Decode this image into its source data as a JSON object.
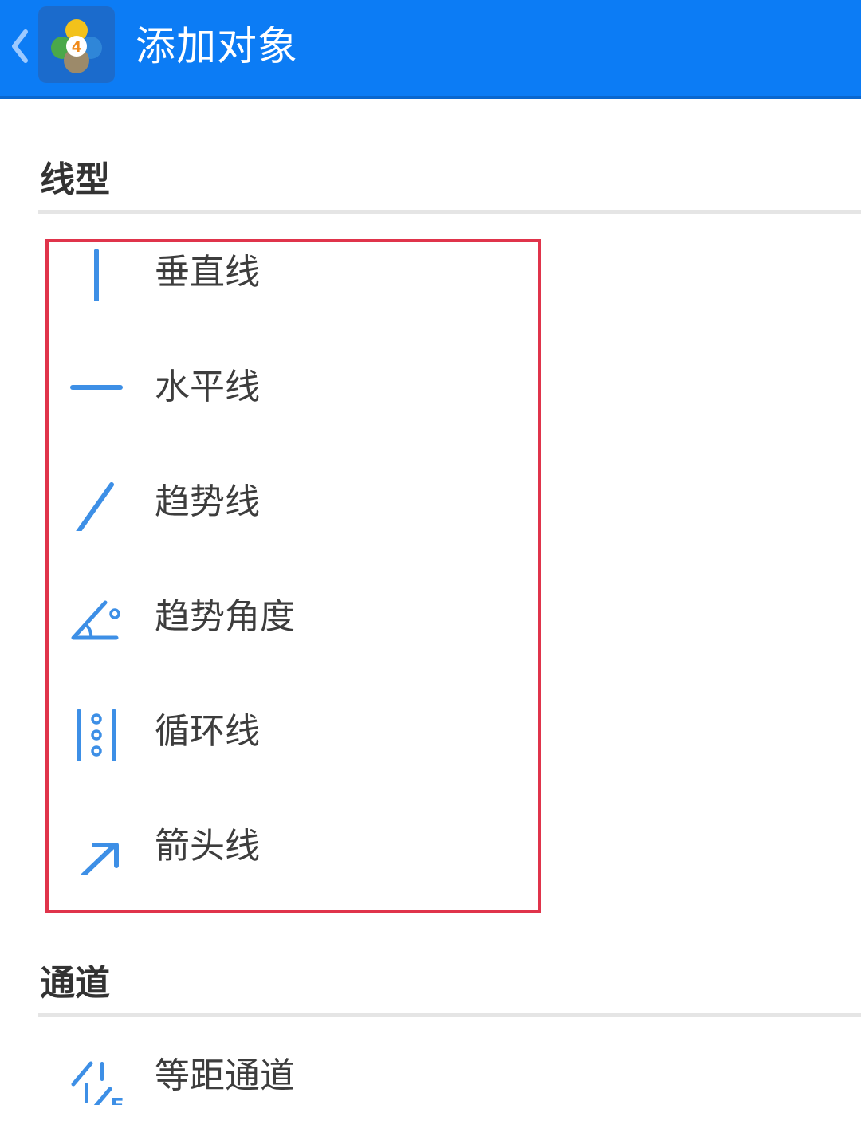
{
  "app_bar": {
    "title": "添加对象",
    "back_icon": "chevron-left-icon",
    "logo": "metatrader-4-logo",
    "background": "#0c7cf5"
  },
  "sections": [
    {
      "title": "线型",
      "highlighted": true,
      "highlight_color": "#e0344b",
      "items": [
        {
          "label": "垂直线",
          "icon": "vertical-line-icon"
        },
        {
          "label": "水平线",
          "icon": "horizontal-line-icon"
        },
        {
          "label": "趋势线",
          "icon": "trend-line-icon"
        },
        {
          "label": "趋势角度",
          "icon": "trend-angle-icon"
        },
        {
          "label": "循环线",
          "icon": "cycle-lines-icon"
        },
        {
          "label": "箭头线",
          "icon": "arrow-line-icon"
        }
      ]
    },
    {
      "title": "通道",
      "items": [
        {
          "label": "等距通道",
          "icon": "equidistant-channel-icon"
        }
      ]
    }
  ],
  "icon_color": "#3d8fe6"
}
